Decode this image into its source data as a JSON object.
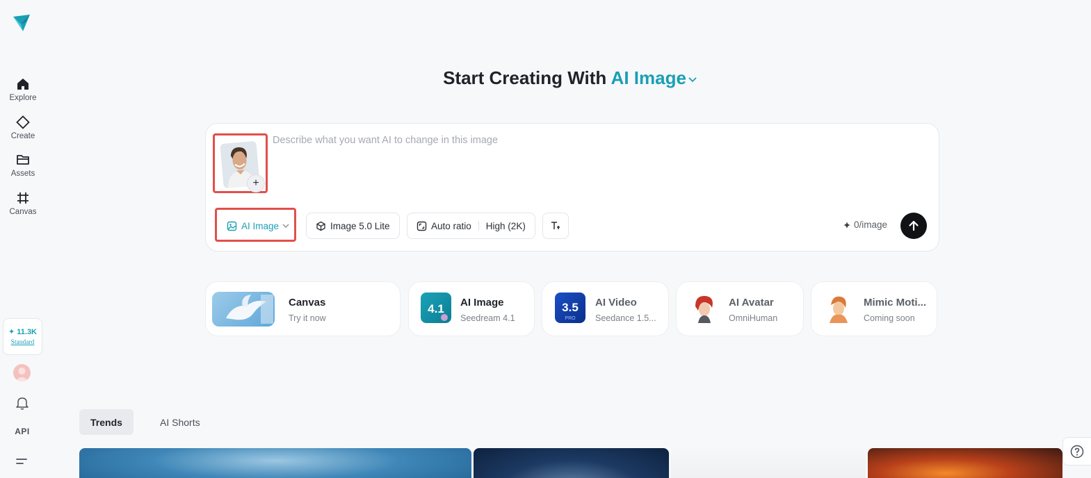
{
  "sidebar": {
    "logo_icon": "paper-plane-logo-icon",
    "items": [
      {
        "label": "Explore",
        "icon": "home-icon"
      },
      {
        "label": "Create",
        "icon": "diamond-icon"
      },
      {
        "label": "Assets",
        "icon": "folder-icon"
      },
      {
        "label": "Canvas",
        "icon": "canvas-grid-icon"
      }
    ],
    "credits": {
      "amount": "✦ 11.3K",
      "tier": "Standard"
    },
    "api_label": "API"
  },
  "header": {
    "title_prefix": "Start Creating With",
    "title_mode": "AI Image"
  },
  "prompt": {
    "placeholder": "Describe what you want AI to change in this image",
    "add_label": "+",
    "mode_label": "AI Image",
    "model_label": "Image 5.0 Lite",
    "ratio_label": "Auto ratio",
    "quality_label": "High (2K)",
    "cost_label": "0/image"
  },
  "features": [
    {
      "title": "Canvas",
      "subtitle": "Try it now"
    },
    {
      "title": "AI Image",
      "subtitle": "Seedream 4.1",
      "badge": "4.1"
    },
    {
      "title": "AI Video",
      "subtitle": "Seedance 1.5...",
      "badge": "3.5",
      "badge_sub": "PRO"
    },
    {
      "title": "AI Avatar",
      "subtitle": "OmniHuman"
    },
    {
      "title": "Mimic Moti...",
      "subtitle": "Coming soon"
    }
  ],
  "tabs": [
    {
      "label": "Trends",
      "active": true
    },
    {
      "label": "AI Shorts",
      "active": false
    }
  ],
  "colors": {
    "accent": "#1a9fb5",
    "highlight": "#e0504a",
    "send": "#101215"
  }
}
